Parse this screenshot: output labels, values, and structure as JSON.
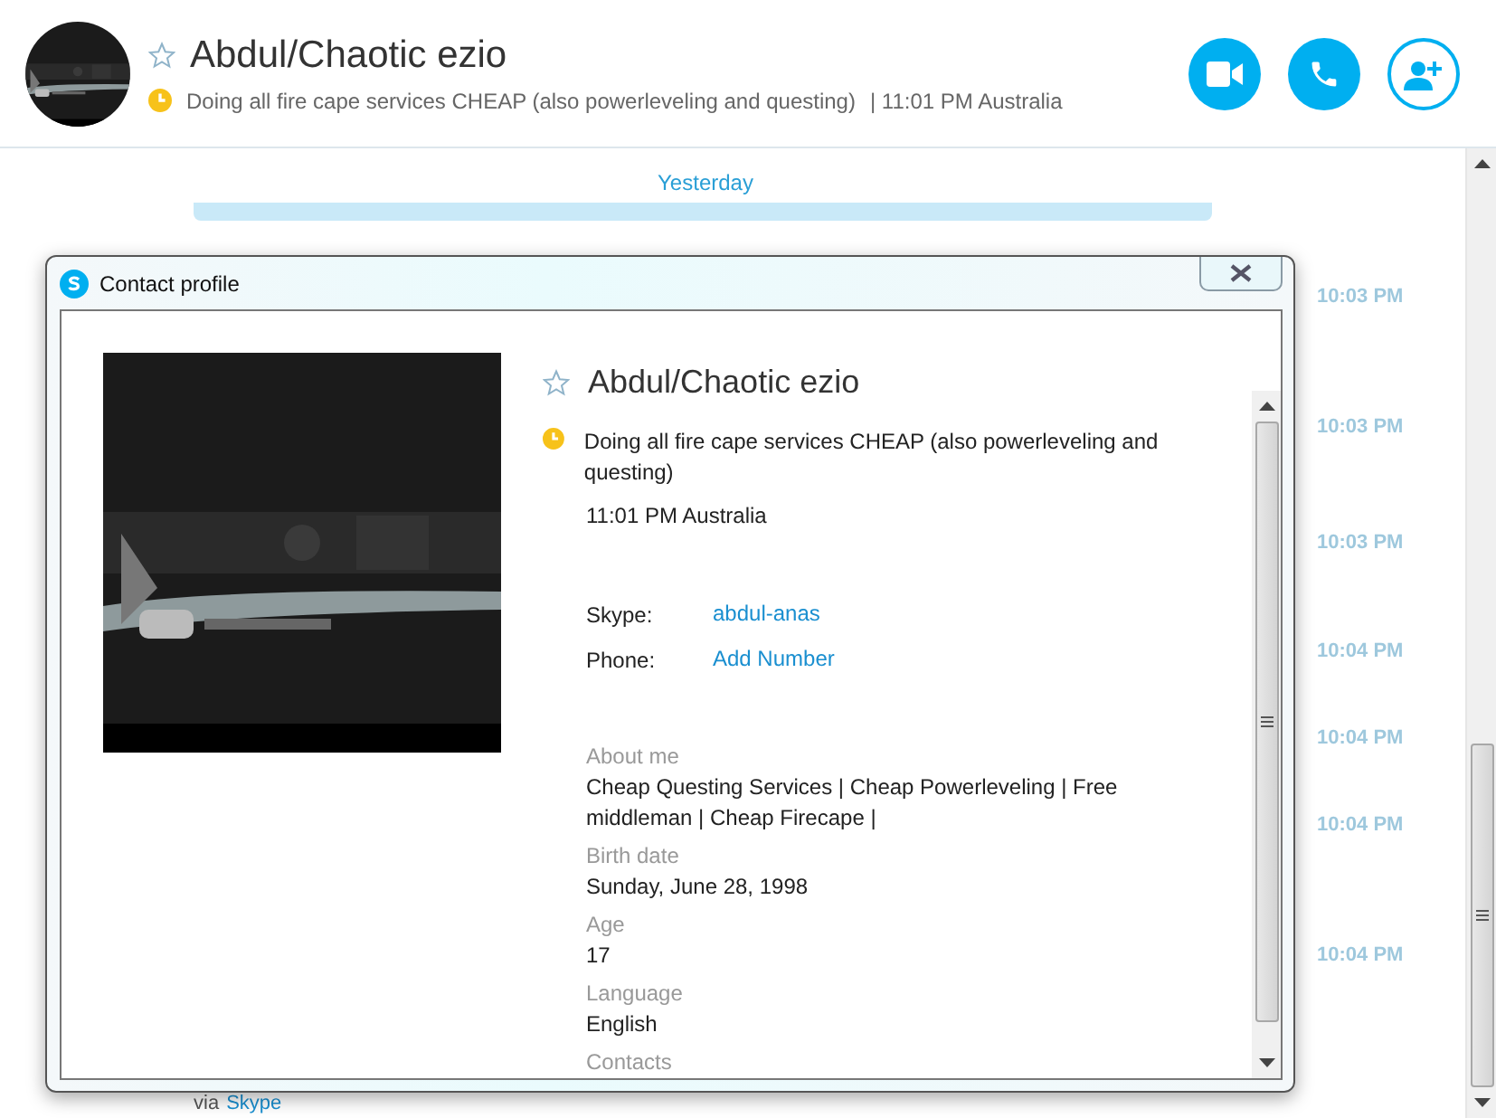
{
  "header": {
    "name": "Abdul/Chaotic ezio",
    "favorite": false,
    "mood": "Doing all fire cape services CHEAP (also powerleveling and questing)",
    "local_time": "| 11:01 PM Australia"
  },
  "chat": {
    "day_divider": "Yesterday",
    "messages": [
      {
        "time": "10:03 PM"
      },
      {
        "time": "10:03 PM"
      },
      {
        "time": "10:03 PM"
      },
      {
        "time": "10:04 PM"
      },
      {
        "time": "10:04 PM"
      },
      {
        "time": "10:04 PM"
      },
      {
        "time": "10:04 PM"
      }
    ],
    "via_label": "via",
    "via_link": "Skype"
  },
  "dialog": {
    "title": "Contact profile",
    "name": "Abdul/Chaotic ezio",
    "favorite": false,
    "mood": "Doing all fire cape services CHEAP (also powerleveling and questing)",
    "local_time": "11:01 PM Australia",
    "contacts": [
      {
        "label": "Skype:",
        "value": "abdul-anas"
      },
      {
        "label": "Phone:",
        "value": "Add Number"
      }
    ],
    "details": [
      {
        "label": "About me",
        "value": "Cheap Questing Services | Cheap Powerleveling | Free middleman | Cheap Firecape |"
      },
      {
        "label": "Birth date",
        "value": "Sunday, June 28, 1998"
      },
      {
        "label": "Age",
        "value": "17"
      },
      {
        "label": "Language",
        "value": "English"
      },
      {
        "label": "Contacts"
      }
    ]
  }
}
